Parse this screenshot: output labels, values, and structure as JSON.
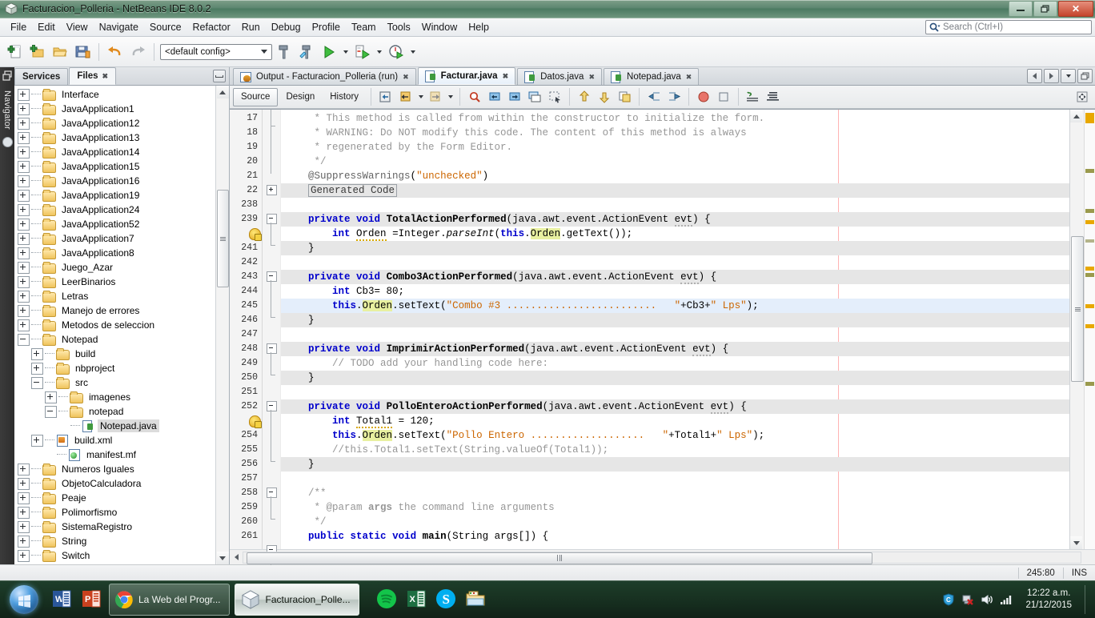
{
  "window": {
    "title": "Facturacion_Polleria - NetBeans IDE 8.0.2",
    "minimize_label": "–",
    "maximize_label": "❐",
    "close_label": "✕"
  },
  "menu": {
    "items": [
      "File",
      "Edit",
      "View",
      "Navigate",
      "Source",
      "Refactor",
      "Run",
      "Debug",
      "Profile",
      "Team",
      "Tools",
      "Window",
      "Help"
    ],
    "search_placeholder": "Search (Ctrl+I)"
  },
  "toolbar": {
    "config_value": "<default config>",
    "buttons": [
      {
        "name": "new-file-button",
        "title": "New File"
      },
      {
        "name": "new-project-button",
        "title": "New Project"
      },
      {
        "name": "open-project-button",
        "title": "Open Project"
      },
      {
        "name": "save-all-button",
        "title": "Save All"
      },
      {
        "name": "undo-button",
        "title": "Undo"
      },
      {
        "name": "redo-button",
        "title": "Redo"
      },
      {
        "name": "build-project-button",
        "title": "Build Project"
      },
      {
        "name": "clean-build-button",
        "title": "Clean and Build Project"
      },
      {
        "name": "run-project-button",
        "title": "Run Project"
      },
      {
        "name": "debug-project-button",
        "title": "Debug Project"
      },
      {
        "name": "profile-project-button",
        "title": "Profile Project"
      }
    ]
  },
  "navigator_strip": {
    "label": "Navigator"
  },
  "explorer": {
    "tabs": [
      {
        "label": "Services",
        "active": false,
        "closable": false
      },
      {
        "label": "Files",
        "active": true,
        "closable": true
      }
    ],
    "tree": [
      {
        "label": "Interface",
        "depth": 0,
        "toggle": "plus",
        "icon": "folder"
      },
      {
        "label": "JavaApplication1",
        "depth": 0,
        "toggle": "plus",
        "icon": "folder"
      },
      {
        "label": "JavaApplication12",
        "depth": 0,
        "toggle": "plus",
        "icon": "folder"
      },
      {
        "label": "JavaApplication13",
        "depth": 0,
        "toggle": "plus",
        "icon": "folder"
      },
      {
        "label": "JavaApplication14",
        "depth": 0,
        "toggle": "plus",
        "icon": "folder"
      },
      {
        "label": "JavaApplication15",
        "depth": 0,
        "toggle": "plus",
        "icon": "folder"
      },
      {
        "label": "JavaApplication16",
        "depth": 0,
        "toggle": "plus",
        "icon": "folder"
      },
      {
        "label": "JavaApplication19",
        "depth": 0,
        "toggle": "plus",
        "icon": "folder"
      },
      {
        "label": "JavaApplication24",
        "depth": 0,
        "toggle": "plus",
        "icon": "folder"
      },
      {
        "label": "JavaApplication52",
        "depth": 0,
        "toggle": "plus",
        "icon": "folder"
      },
      {
        "label": "JavaApplication7",
        "depth": 0,
        "toggle": "plus",
        "icon": "folder"
      },
      {
        "label": "JavaApplication8",
        "depth": 0,
        "toggle": "plus",
        "icon": "folder"
      },
      {
        "label": "Juego_Azar",
        "depth": 0,
        "toggle": "plus",
        "icon": "folder"
      },
      {
        "label": "LeerBinarios",
        "depth": 0,
        "toggle": "plus",
        "icon": "folder"
      },
      {
        "label": "Letras",
        "depth": 0,
        "toggle": "plus",
        "icon": "folder"
      },
      {
        "label": "Manejo de errores",
        "depth": 0,
        "toggle": "plus",
        "icon": "folder"
      },
      {
        "label": "Metodos de seleccion",
        "depth": 0,
        "toggle": "plus",
        "icon": "folder"
      },
      {
        "label": "Notepad",
        "depth": 0,
        "toggle": "minus",
        "icon": "folder"
      },
      {
        "label": "build",
        "depth": 1,
        "toggle": "plus",
        "icon": "folder"
      },
      {
        "label": "nbproject",
        "depth": 1,
        "toggle": "plus",
        "icon": "folder"
      },
      {
        "label": "src",
        "depth": 1,
        "toggle": "minus",
        "icon": "folder"
      },
      {
        "label": "imagenes",
        "depth": 2,
        "toggle": "plus",
        "icon": "folder"
      },
      {
        "label": "notepad",
        "depth": 2,
        "toggle": "minus",
        "icon": "folder"
      },
      {
        "label": "Notepad.java",
        "depth": 3,
        "toggle": "none",
        "icon": "java",
        "selected": true
      },
      {
        "label": "build.xml",
        "depth": 1,
        "toggle": "plus",
        "icon": "xml"
      },
      {
        "label": "manifest.mf",
        "depth": 2,
        "toggle": "none",
        "icon": "manifest"
      },
      {
        "label": "Numeros Iguales",
        "depth": 0,
        "toggle": "plus",
        "icon": "folder"
      },
      {
        "label": "ObjetoCalculadora",
        "depth": 0,
        "toggle": "plus",
        "icon": "folder"
      },
      {
        "label": "Peaje",
        "depth": 0,
        "toggle": "plus",
        "icon": "folder"
      },
      {
        "label": "Polimorfismo",
        "depth": 0,
        "toggle": "plus",
        "icon": "folder"
      },
      {
        "label": "SistemaRegistro",
        "depth": 0,
        "toggle": "plus",
        "icon": "folder"
      },
      {
        "label": "String",
        "depth": 0,
        "toggle": "plus",
        "icon": "folder"
      },
      {
        "label": "Switch",
        "depth": 0,
        "toggle": "plus",
        "icon": "folder"
      }
    ]
  },
  "editor": {
    "tabs": [
      {
        "label": "Output - Facturacion_Polleria (run)",
        "icon": "output",
        "active": false,
        "closable": true
      },
      {
        "label": "Facturar.java",
        "icon": "java",
        "active": true,
        "closable": true
      },
      {
        "label": "Datos.java",
        "icon": "java",
        "active": false,
        "closable": true
      },
      {
        "label": "Notepad.java",
        "icon": "java",
        "active": false,
        "closable": true
      }
    ],
    "view_tabs": [
      {
        "label": "Source",
        "active": true
      },
      {
        "label": "Design",
        "active": false
      },
      {
        "label": "History",
        "active": false
      }
    ],
    "toolbar_buttons": [
      {
        "name": "last-edit-button"
      },
      {
        "name": "back-button"
      },
      {
        "name": "forward-button"
      },
      {
        "name": "find-selection-button"
      },
      {
        "name": "find-previous-button"
      },
      {
        "name": "find-next-button"
      },
      {
        "name": "toggle-rect-select-button"
      },
      {
        "name": "previous-bookmark-button"
      },
      {
        "name": "shift-left-button"
      },
      {
        "name": "shift-right-button"
      },
      {
        "name": "start-macro-button"
      },
      {
        "name": "stop-macro-button"
      },
      {
        "name": "diff-button"
      },
      {
        "name": "format-button"
      }
    ],
    "lines": [
      {
        "num": "17",
        "shade": false,
        "html": "     <span class='cm'>* This method is called from within the constructor to initialize the form.</span>"
      },
      {
        "num": "18",
        "shade": false,
        "html": "     <span class='cm'>* WARNING: Do NOT modify this code. The content of this method is always</span>"
      },
      {
        "num": "19",
        "shade": false,
        "html": "     <span class='cm'>* regenerated by the Form Editor.</span>"
      },
      {
        "num": "20",
        "shade": false,
        "html": "     <span class='cm'>*/</span>"
      },
      {
        "num": "21",
        "shade": false,
        "html": "    <span class='anno'>@SuppressWarnings</span>(<span class='str'>\"unchecked\"</span>)"
      },
      {
        "num": "22",
        "shade": true,
        "html": "    <span style='border:1px solid #9aa0a6;padding:0 2px;color:#3a3a3a;'>Generated Code</span>"
      },
      {
        "num": "238",
        "shade": false,
        "html": ""
      },
      {
        "num": "239",
        "shade": true,
        "html": "    <span class='kw'>private</span> <span class='kw'>void</span> <span class='mname'>TotalActionPerformed</span>(java.awt.event.ActionEvent <span class='sq-und'>evt</span>) {"
      },
      {
        "num": "",
        "shade": false,
        "warn": true,
        "html": "        <span class='kw'>int</span> <span class='sq-und' style='border-color:#d8a800;'>Orden</span> =Integer.<span class='ital'>parseInt</span>(<span class='kw'>this</span>.<span class='hl'>Orden</span>.getText());"
      },
      {
        "num": "241",
        "shade": true,
        "html": "    }"
      },
      {
        "num": "242",
        "shade": false,
        "html": ""
      },
      {
        "num": "243",
        "shade": true,
        "html": "    <span class='kw'>private</span> <span class='kw'>void</span> <span class='mname'>Combo3ActionPerformed</span>(java.awt.event.ActionEvent <span class='sq-und'>evt</span>) {"
      },
      {
        "num": "244",
        "shade": false,
        "html": "        <span class='kw'>int</span> Cb3= 80;"
      },
      {
        "num": "245",
        "shade": false,
        "cur": true,
        "html": "        <span class='kw'>this</span>.<span class='hl'>Orden</span>.setText(<span class='str'>\"Combo #3 .........................   \"</span>+Cb3+<span class='str'>\" Lps\"</span>);"
      },
      {
        "num": "246",
        "shade": true,
        "html": "    }"
      },
      {
        "num": "247",
        "shade": false,
        "html": ""
      },
      {
        "num": "248",
        "shade": true,
        "html": "    <span class='kw'>private</span> <span class='kw'>void</span> <span class='mname'>ImprimirActionPerformed</span>(java.awt.event.ActionEvent <span class='sq-und'>evt</span>) {"
      },
      {
        "num": "249",
        "shade": false,
        "html": "        <span class='cm'>// TODO add your handling code here:</span>"
      },
      {
        "num": "250",
        "shade": true,
        "html": "    }"
      },
      {
        "num": "251",
        "shade": false,
        "html": ""
      },
      {
        "num": "252",
        "shade": true,
        "html": "    <span class='kw'>private</span> <span class='kw'>void</span> <span class='mname'>PolloEnteroActionPerformed</span>(java.awt.event.ActionEvent <span class='sq-und'>evt</span>) {"
      },
      {
        "num": "",
        "shade": false,
        "warn": true,
        "html": "        <span class='kw'>int</span> <span class='sq-und' style='border-color:#d8a800;'>Total1</span> = 120;"
      },
      {
        "num": "254",
        "shade": false,
        "html": "        <span class='kw'>this</span>.<span class='hl'>Orden</span>.setText(<span class='str'>\"Pollo Entero ...................   \"</span>+Total1+<span class='str'>\" Lps\"</span>);"
      },
      {
        "num": "255",
        "shade": false,
        "html": "        <span class='cm'>//this.Total1.setText(String.valueOf(Total1));</span>"
      },
      {
        "num": "256",
        "shade": true,
        "html": "    }"
      },
      {
        "num": "257",
        "shade": false,
        "html": ""
      },
      {
        "num": "258",
        "shade": false,
        "html": "    <span class='cm'>/**</span>"
      },
      {
        "num": "259",
        "shade": false,
        "html": "     <span class='cm'>* @param <b>args</b> the command line arguments</span>"
      },
      {
        "num": "260",
        "shade": false,
        "html": "     <span class='cm'>*/</span>"
      },
      {
        "num": "261",
        "shade": false,
        "html": "    <span class='kw'>public</span> <span class='kw'>static</span> <span class='kw'>void</span> <span class='mname'>main</span>(String args[]) {"
      }
    ]
  },
  "status": {
    "position": "245:80",
    "insert_mode": "INS"
  },
  "taskbar": {
    "start_label": "Start",
    "pinned": [
      {
        "name": "word-icon",
        "label": "W"
      },
      {
        "name": "powerpoint-icon",
        "label": "P"
      }
    ],
    "windows": [
      {
        "name": "chrome-window",
        "label": "La Web del Progr...",
        "icon": "chrome-icon",
        "active": false
      },
      {
        "name": "netbeans-window",
        "label": "Facturacion_Polle...",
        "icon": "netbeans-icon",
        "active": true
      }
    ],
    "apps": [
      {
        "name": "spotify-icon",
        "label": ""
      },
      {
        "name": "excel-icon",
        "label": "X"
      },
      {
        "name": "skype-icon",
        "label": "S"
      },
      {
        "name": "explorer-icon",
        "label": ""
      }
    ],
    "tray": [
      {
        "name": "security-shield-icon"
      },
      {
        "name": "network-error-icon"
      },
      {
        "name": "volume-icon"
      },
      {
        "name": "signal-icon"
      }
    ],
    "clock_time": "12:22 a.m.",
    "clock_date": "21/12/2015"
  },
  "colors": {
    "accent": "#4b7a61",
    "keyword": "#0000cc",
    "string": "#cc6600",
    "comment": "#969696",
    "highlight": "#e8f0a0",
    "warn_mark": "#e8a800",
    "olive_mark": "#9a9a4d"
  }
}
